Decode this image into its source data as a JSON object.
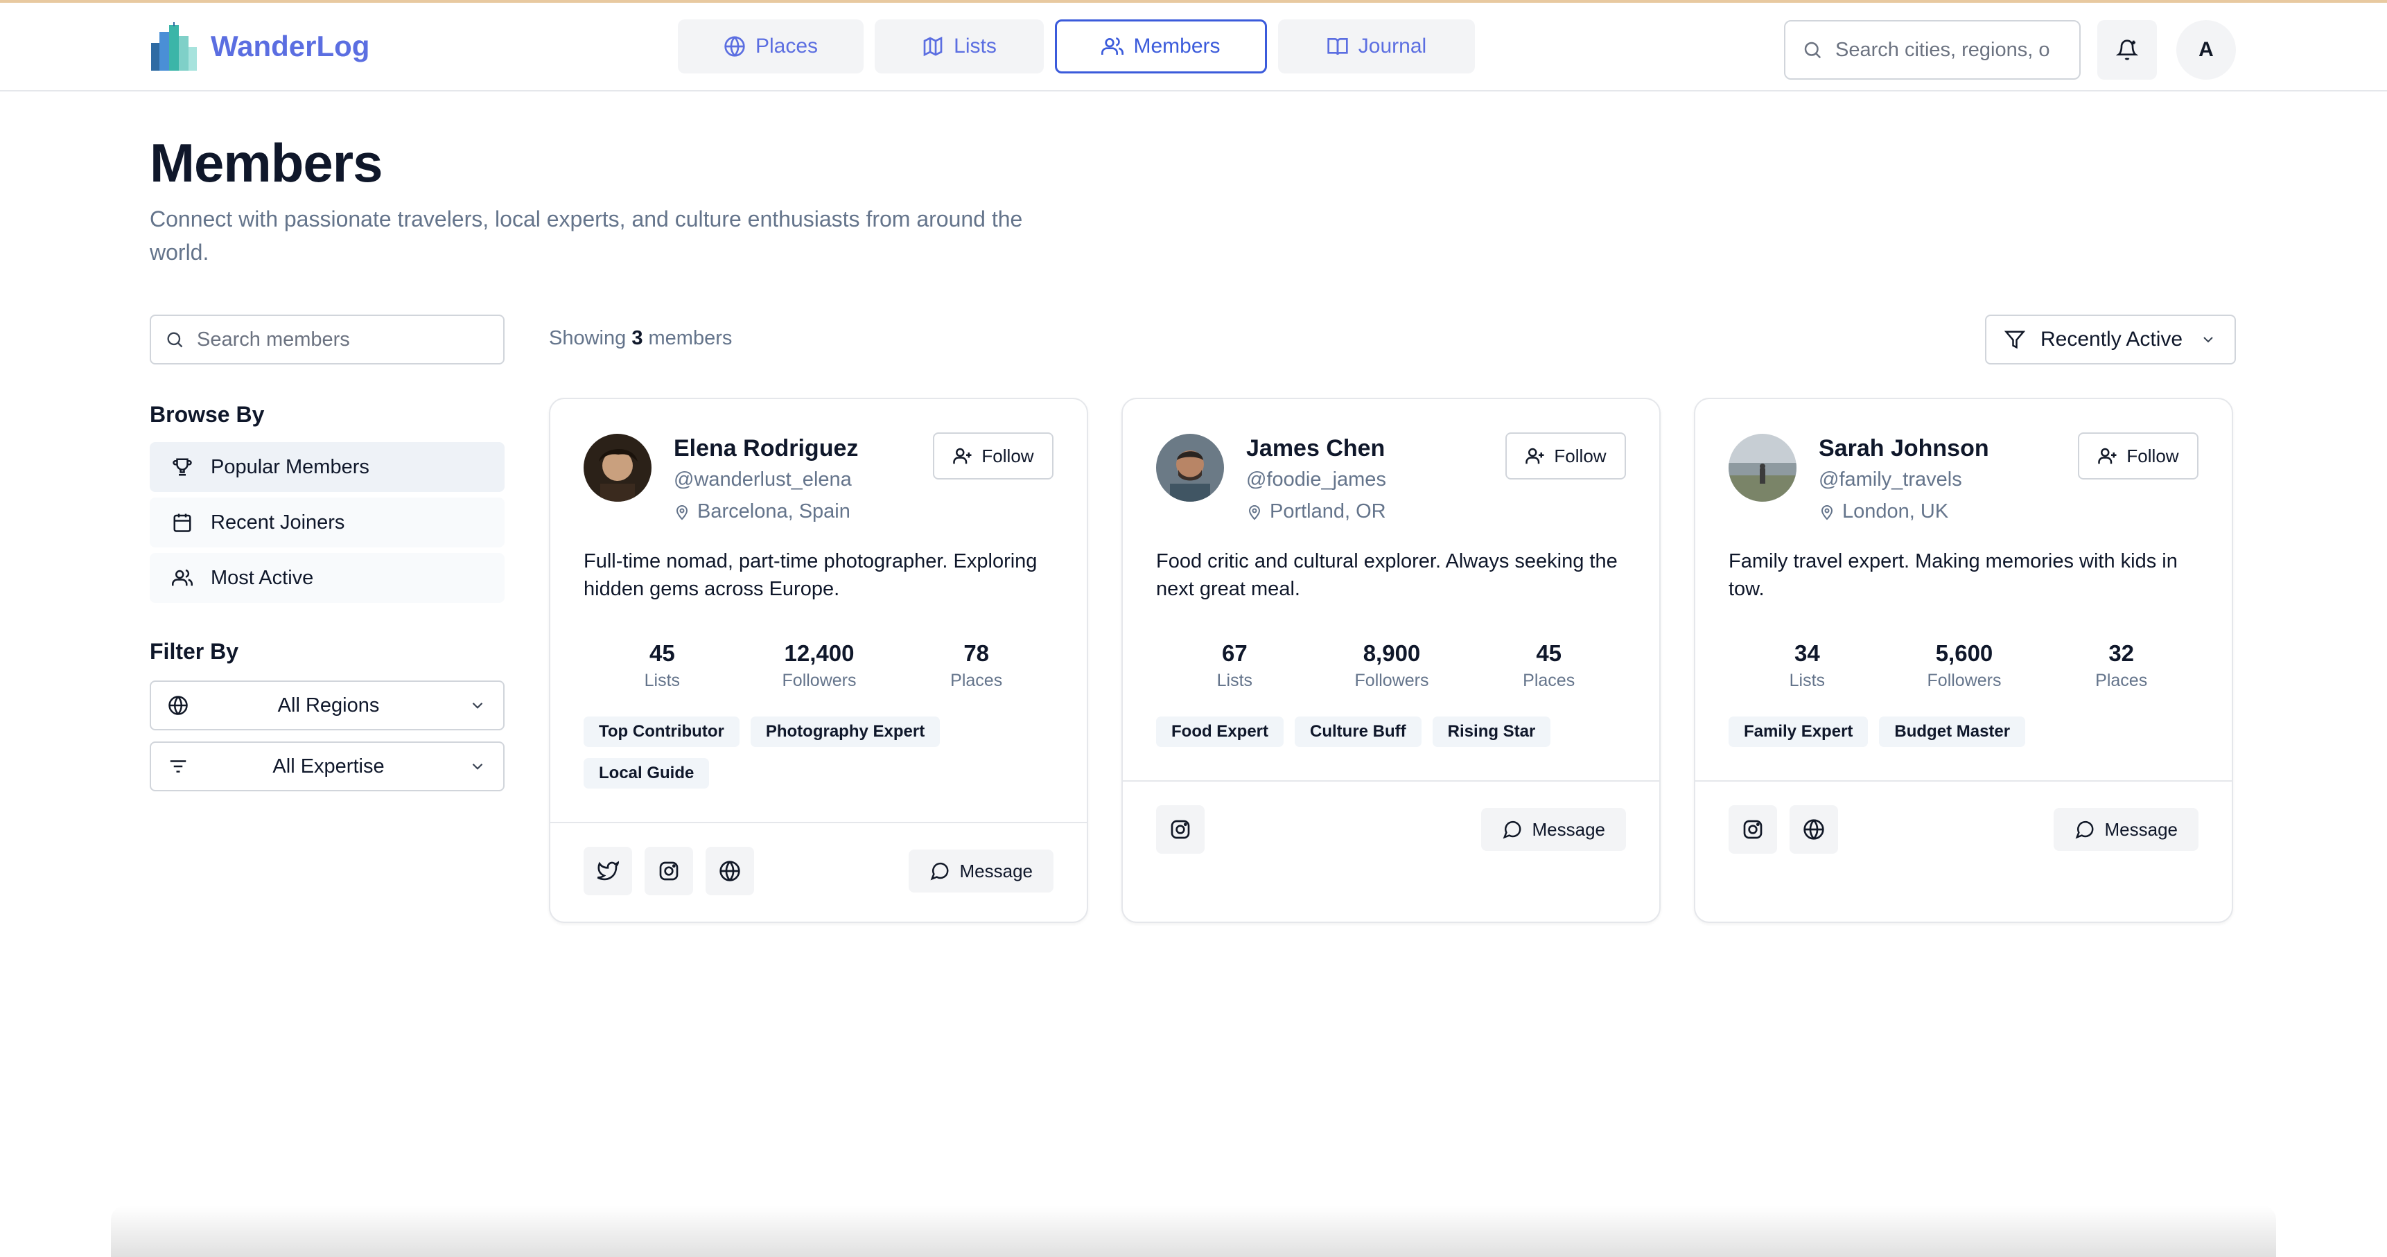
{
  "app": {
    "name": "WanderLog",
    "logo_colors": [
      "#2f6ba3",
      "#3bb5a8",
      "#7fd0c8",
      "#4a8fd6"
    ]
  },
  "nav": {
    "tabs": [
      {
        "label": "Places",
        "icon": "globe-icon"
      },
      {
        "label": "Lists",
        "icon": "map-icon"
      },
      {
        "label": "Members",
        "icon": "users-icon",
        "active": true
      },
      {
        "label": "Journal",
        "icon": "book-icon"
      }
    ]
  },
  "header": {
    "search_placeholder": "Search cities, regions, o",
    "user_initial": "A"
  },
  "page": {
    "title": "Members",
    "subtitle": "Connect with passionate travelers, local experts, and culture enthusiasts from around the world."
  },
  "sidebar": {
    "search_placeholder": "Search members",
    "browse_heading": "Browse By",
    "browse_items": [
      {
        "label": "Popular Members",
        "icon": "trophy-icon",
        "active": true
      },
      {
        "label": "Recent Joiners",
        "icon": "calendar-icon"
      },
      {
        "label": "Most Active",
        "icon": "users-icon"
      }
    ],
    "filter_heading": "Filter By",
    "region_select": "All Regions",
    "expertise_select": "All Expertise"
  },
  "results": {
    "showing_prefix": "Showing",
    "count": "3",
    "showing_suffix": "members",
    "sort_label": "Recently Active"
  },
  "members": [
    {
      "name": "Elena Rodriguez",
      "handle": "@wanderlust_elena",
      "location": "Barcelona, Spain",
      "bio": "Full-time nomad, part-time photographer. Exploring hidden gems across Europe.",
      "stats": [
        {
          "value": "45",
          "label": "Lists"
        },
        {
          "value": "12,400",
          "label": "Followers"
        },
        {
          "value": "78",
          "label": "Places"
        }
      ],
      "tags": [
        "Top Contributor",
        "Photography Expert",
        "Local Guide"
      ],
      "socials": [
        "twitter-icon",
        "instagram-icon",
        "globe-icon"
      ],
      "follow_label": "Follow",
      "message_label": "Message"
    },
    {
      "name": "James Chen",
      "handle": "@foodie_james",
      "location": "Portland, OR",
      "bio": "Food critic and cultural explorer. Always seeking the next great meal.",
      "stats": [
        {
          "value": "67",
          "label": "Lists"
        },
        {
          "value": "8,900",
          "label": "Followers"
        },
        {
          "value": "45",
          "label": "Places"
        }
      ],
      "tags": [
        "Food Expert",
        "Culture Buff",
        "Rising Star"
      ],
      "socials": [
        "instagram-icon"
      ],
      "follow_label": "Follow",
      "message_label": "Message"
    },
    {
      "name": "Sarah Johnson",
      "handle": "@family_travels",
      "location": "London, UK",
      "bio": "Family travel expert. Making memories with kids in tow.",
      "stats": [
        {
          "value": "34",
          "label": "Lists"
        },
        {
          "value": "5,600",
          "label": "Followers"
        },
        {
          "value": "32",
          "label": "Places"
        }
      ],
      "tags": [
        "Family Expert",
        "Budget Master"
      ],
      "socials": [
        "instagram-icon",
        "globe-icon"
      ],
      "follow_label": "Follow",
      "message_label": "Message"
    }
  ]
}
